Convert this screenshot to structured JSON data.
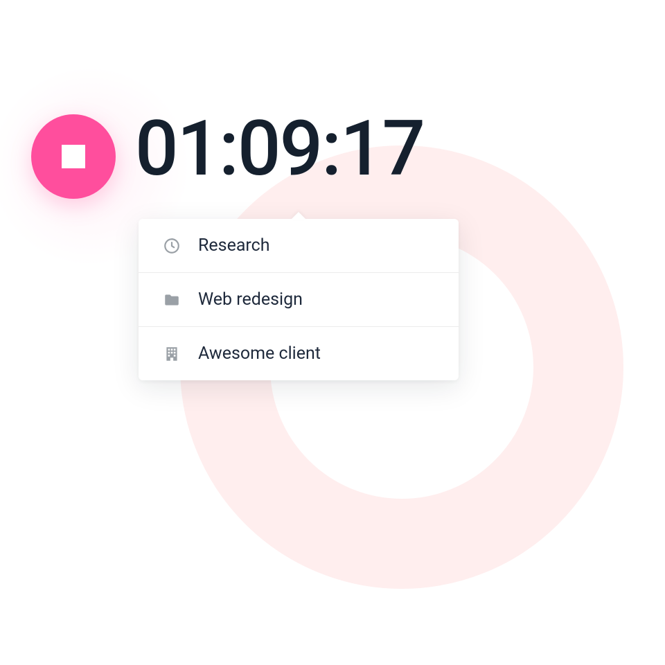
{
  "timer": {
    "value": "01:09:17"
  },
  "popover": {
    "items": [
      {
        "icon": "clock-icon",
        "label": "Research"
      },
      {
        "icon": "folder-icon",
        "label": "Web redesign"
      },
      {
        "icon": "building-icon",
        "label": "Awesome client"
      }
    ]
  },
  "colors": {
    "accent": "#FF4E9D",
    "ring": "#FFEEEE",
    "text": "#15202E",
    "muted": "#9AA0A6"
  }
}
